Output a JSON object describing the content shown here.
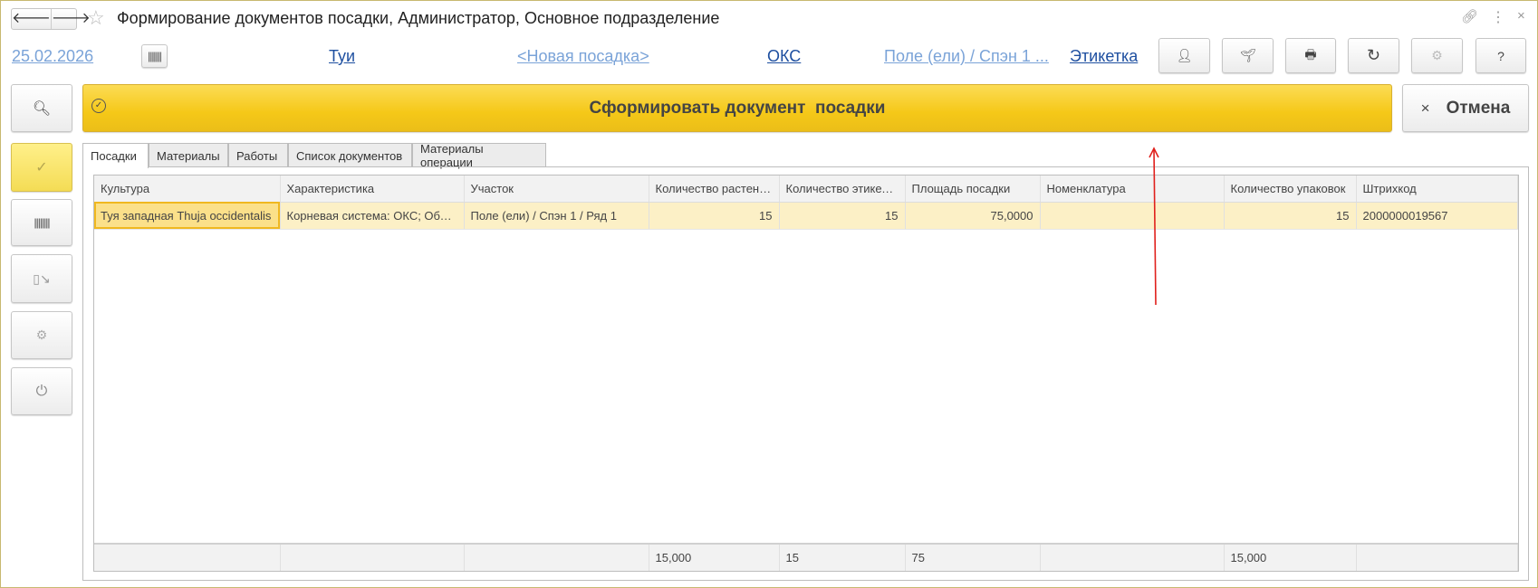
{
  "window": {
    "title": "Формирование документов посадки, Администратор, Основное подразделение"
  },
  "header": {
    "date": "25.02.2026",
    "culture": "Туи",
    "planting": "<Новая посадка>",
    "root": "ОКС",
    "location": "Поле (ели) / Спэн 1 ...",
    "label": "Этикетка",
    "help": "?"
  },
  "actions": {
    "create": "Сформировать документ  посадки",
    "cancel": "Отмена",
    "cancel_icon": "×"
  },
  "tabs": [
    {
      "label": "Посадки",
      "active": true
    },
    {
      "label": "Материалы"
    },
    {
      "label": "Работы"
    },
    {
      "label": "Список документов"
    },
    {
      "label": "Материалы операции"
    }
  ],
  "table": {
    "columns": [
      "Культура",
      "Характеристика",
      "Участок",
      "Количество растений",
      "Количество этикеток",
      "Площадь посадки",
      "Номенклатура",
      "Количество упаковок",
      "Штрихкод"
    ],
    "rows": [
      [
        "Туя западная Thuja occidentalis",
        "Корневая система: ОКС; Объем",
        "Поле (ели) / Спэн 1 / Ряд 1",
        "15",
        "15",
        "75,0000",
        "",
        "15",
        "2000000019567"
      ]
    ],
    "totals": [
      "",
      "",
      "",
      "15,000",
      "15",
      "75",
      "",
      "15,000",
      ""
    ]
  },
  "colors": {
    "accent": "#f5c818",
    "selected_row": "#fcf0c6",
    "link": "#1e4fa0",
    "arrow": "#e0201c"
  }
}
